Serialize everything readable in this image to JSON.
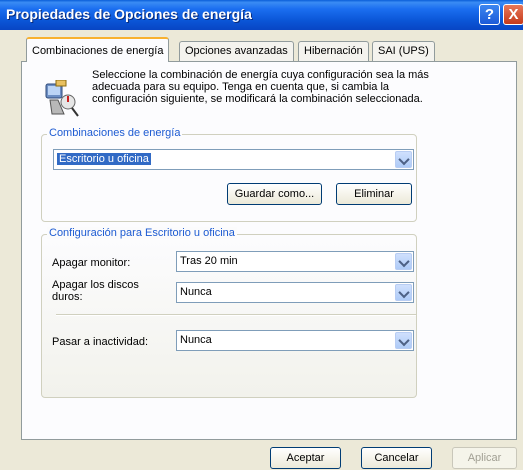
{
  "window": {
    "title": "Propiedades de Opciones de energía",
    "help_label": "?",
    "close_label": "X"
  },
  "tabs": [
    {
      "label": "Combinaciones de energía",
      "active": true
    },
    {
      "label": "Opciones avanzadas",
      "active": false
    },
    {
      "label": "Hibernación",
      "active": false
    },
    {
      "label": "SAI (UPS)",
      "active": false
    }
  ],
  "intro": {
    "icon": "power-schemes-icon",
    "text": "Seleccione la combinación de energía cuya configuración sea la más adecuada para su equipo. Tenga en cuenta que, si cambia la configuración siguiente, se modificará la combinación seleccionada."
  },
  "schemes": {
    "group_title": "Combinaciones de energía",
    "selected": "Escritorio u oficina",
    "save_as_label": "Guardar como...",
    "delete_label": "Eliminar"
  },
  "settings": {
    "group_title": "Configuración para Escritorio u oficina",
    "monitor_label": "Apagar monitor:",
    "monitor_value": "Tras 20 min",
    "disks_label": "Apagar los discos duros:",
    "disks_value": "Nunca",
    "standby_label": "Pasar a inactividad:",
    "standby_value": "Nunca"
  },
  "footer": {
    "ok_label": "Aceptar",
    "cancel_label": "Cancelar",
    "apply_label": "Aplicar"
  },
  "colors": {
    "title_bar": "#0a55d6",
    "group_title": "#1d5bd2",
    "active_tab_accent": "#f8b130",
    "selection": "#316ac5"
  }
}
